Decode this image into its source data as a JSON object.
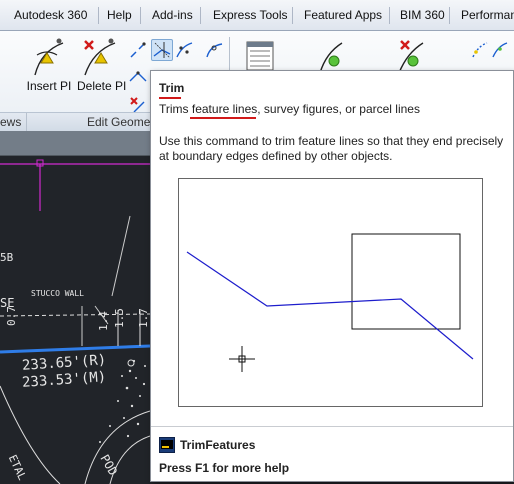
{
  "menubar": {
    "items": [
      "Autodesk 360",
      "Help",
      "Add-ins",
      "Express Tools",
      "Featured Apps",
      "BIM 360",
      "Performan"
    ]
  },
  "ribbon": {
    "insert_pi_label": "Insert PI",
    "delete_pi_label": "Delete PI",
    "panel_views_label": "ews",
    "panel_edit_geometry_label": "Edit Geome"
  },
  "drawing": {
    "label_5b": "5B",
    "label_se": "SE",
    "label_07": "0.7",
    "label_stucco": "STUCCO WALL",
    "label_14": "1.4",
    "label_15": "1.5",
    "label_17": "1.7",
    "label_dist_r": "233.65'(R)",
    "label_dist_m": "233.53'(M)",
    "label_pod": "POD",
    "label_etal": "ETAL"
  },
  "tooltip": {
    "title": "Trim",
    "summary": "Trims feature lines, survey figures, or parcel lines",
    "description": "Use this command to trim feature lines so that they end precisely at boundary edges defined by other objects.",
    "command_name": "TrimFeatures",
    "help_hint": "Press F1 for more help"
  },
  "colors": {
    "accent_red": "#d11a1a",
    "preview_line": "#1d1dcc",
    "cad_blue": "#2f7de8",
    "cad_magenta": "#d02ad0"
  }
}
